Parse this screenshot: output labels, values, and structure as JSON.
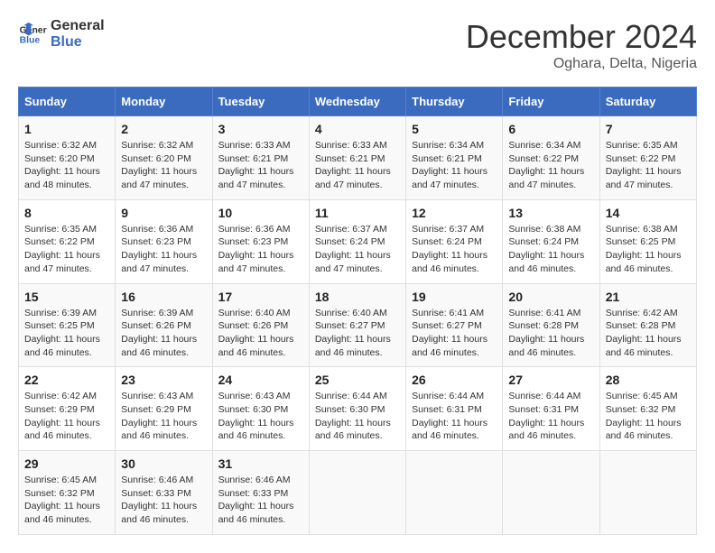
{
  "header": {
    "logo_line1": "General",
    "logo_line2": "Blue",
    "month": "December 2024",
    "location": "Oghara, Delta, Nigeria"
  },
  "days_of_week": [
    "Sunday",
    "Monday",
    "Tuesday",
    "Wednesday",
    "Thursday",
    "Friday",
    "Saturday"
  ],
  "weeks": [
    [
      {
        "day": "1",
        "sunrise": "6:32 AM",
        "sunset": "6:20 PM",
        "daylight": "11 hours and 48 minutes."
      },
      {
        "day": "2",
        "sunrise": "6:32 AM",
        "sunset": "6:20 PM",
        "daylight": "11 hours and 47 minutes."
      },
      {
        "day": "3",
        "sunrise": "6:33 AM",
        "sunset": "6:21 PM",
        "daylight": "11 hours and 47 minutes."
      },
      {
        "day": "4",
        "sunrise": "6:33 AM",
        "sunset": "6:21 PM",
        "daylight": "11 hours and 47 minutes."
      },
      {
        "day": "5",
        "sunrise": "6:34 AM",
        "sunset": "6:21 PM",
        "daylight": "11 hours and 47 minutes."
      },
      {
        "day": "6",
        "sunrise": "6:34 AM",
        "sunset": "6:22 PM",
        "daylight": "11 hours and 47 minutes."
      },
      {
        "day": "7",
        "sunrise": "6:35 AM",
        "sunset": "6:22 PM",
        "daylight": "11 hours and 47 minutes."
      }
    ],
    [
      {
        "day": "8",
        "sunrise": "6:35 AM",
        "sunset": "6:22 PM",
        "daylight": "11 hours and 47 minutes."
      },
      {
        "day": "9",
        "sunrise": "6:36 AM",
        "sunset": "6:23 PM",
        "daylight": "11 hours and 47 minutes."
      },
      {
        "day": "10",
        "sunrise": "6:36 AM",
        "sunset": "6:23 PM",
        "daylight": "11 hours and 47 minutes."
      },
      {
        "day": "11",
        "sunrise": "6:37 AM",
        "sunset": "6:24 PM",
        "daylight": "11 hours and 47 minutes."
      },
      {
        "day": "12",
        "sunrise": "6:37 AM",
        "sunset": "6:24 PM",
        "daylight": "11 hours and 46 minutes."
      },
      {
        "day": "13",
        "sunrise": "6:38 AM",
        "sunset": "6:24 PM",
        "daylight": "11 hours and 46 minutes."
      },
      {
        "day": "14",
        "sunrise": "6:38 AM",
        "sunset": "6:25 PM",
        "daylight": "11 hours and 46 minutes."
      }
    ],
    [
      {
        "day": "15",
        "sunrise": "6:39 AM",
        "sunset": "6:25 PM",
        "daylight": "11 hours and 46 minutes."
      },
      {
        "day": "16",
        "sunrise": "6:39 AM",
        "sunset": "6:26 PM",
        "daylight": "11 hours and 46 minutes."
      },
      {
        "day": "17",
        "sunrise": "6:40 AM",
        "sunset": "6:26 PM",
        "daylight": "11 hours and 46 minutes."
      },
      {
        "day": "18",
        "sunrise": "6:40 AM",
        "sunset": "6:27 PM",
        "daylight": "11 hours and 46 minutes."
      },
      {
        "day": "19",
        "sunrise": "6:41 AM",
        "sunset": "6:27 PM",
        "daylight": "11 hours and 46 minutes."
      },
      {
        "day": "20",
        "sunrise": "6:41 AM",
        "sunset": "6:28 PM",
        "daylight": "11 hours and 46 minutes."
      },
      {
        "day": "21",
        "sunrise": "6:42 AM",
        "sunset": "6:28 PM",
        "daylight": "11 hours and 46 minutes."
      }
    ],
    [
      {
        "day": "22",
        "sunrise": "6:42 AM",
        "sunset": "6:29 PM",
        "daylight": "11 hours and 46 minutes."
      },
      {
        "day": "23",
        "sunrise": "6:43 AM",
        "sunset": "6:29 PM",
        "daylight": "11 hours and 46 minutes."
      },
      {
        "day": "24",
        "sunrise": "6:43 AM",
        "sunset": "6:30 PM",
        "daylight": "11 hours and 46 minutes."
      },
      {
        "day": "25",
        "sunrise": "6:44 AM",
        "sunset": "6:30 PM",
        "daylight": "11 hours and 46 minutes."
      },
      {
        "day": "26",
        "sunrise": "6:44 AM",
        "sunset": "6:31 PM",
        "daylight": "11 hours and 46 minutes."
      },
      {
        "day": "27",
        "sunrise": "6:44 AM",
        "sunset": "6:31 PM",
        "daylight": "11 hours and 46 minutes."
      },
      {
        "day": "28",
        "sunrise": "6:45 AM",
        "sunset": "6:32 PM",
        "daylight": "11 hours and 46 minutes."
      }
    ],
    [
      {
        "day": "29",
        "sunrise": "6:45 AM",
        "sunset": "6:32 PM",
        "daylight": "11 hours and 46 minutes."
      },
      {
        "day": "30",
        "sunrise": "6:46 AM",
        "sunset": "6:33 PM",
        "daylight": "11 hours and 46 minutes."
      },
      {
        "day": "31",
        "sunrise": "6:46 AM",
        "sunset": "6:33 PM",
        "daylight": "11 hours and 46 minutes."
      },
      null,
      null,
      null,
      null
    ]
  ]
}
